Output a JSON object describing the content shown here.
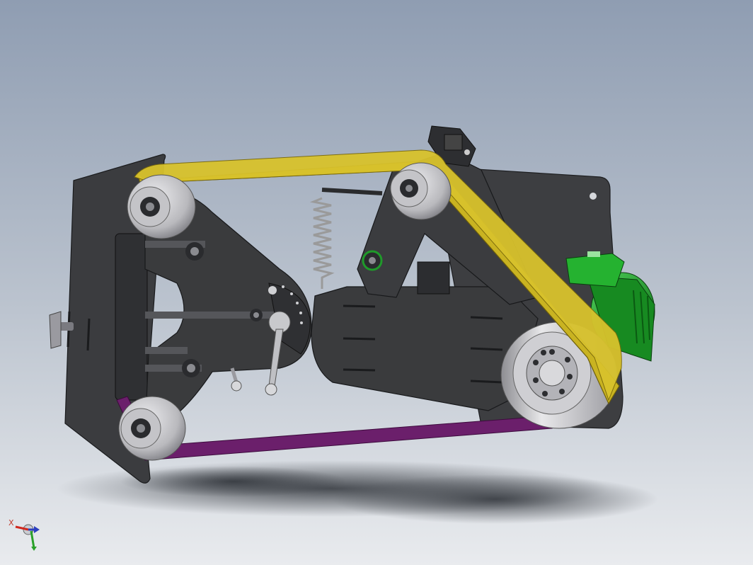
{
  "viewport": {
    "background_top": "#8f9db2",
    "background_bottom": "#e9ebee"
  },
  "model": {
    "plate_color": "#3a3b3d",
    "upper_belt_color": "#c9b321",
    "lower_belt_color": "#6b1f6b",
    "motor_color": "#1f9a2a",
    "wheel_color": "#b9b9bd",
    "spring_color": "#9a9a9a"
  },
  "triad": {
    "x_label": "X",
    "x_color": "#d0281e",
    "y_color": "#2aa12a",
    "z_color": "#2c3fbf"
  }
}
